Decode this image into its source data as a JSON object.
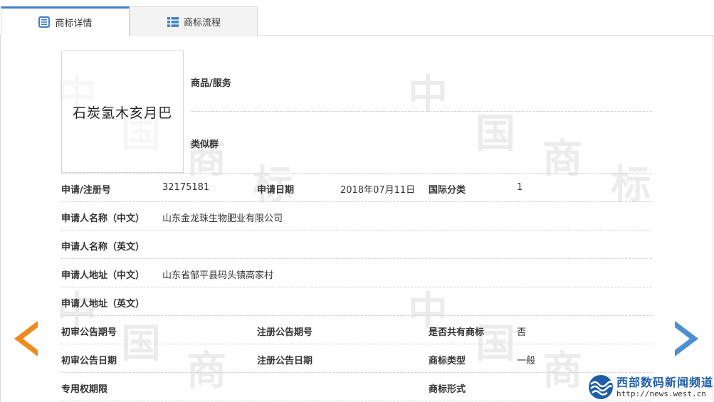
{
  "tabs": [
    {
      "label": "商标详情",
      "active": true
    },
    {
      "label": "商标流程",
      "active": false
    }
  ],
  "watermark": {
    "chars": [
      "中",
      "国",
      "商",
      "标"
    ]
  },
  "trademark": {
    "image_text": "石炭氢木亥月巴"
  },
  "top_fields": {
    "goods_services_label": "商品/服务",
    "similar_group_label": "类似群"
  },
  "rows": {
    "reg_no_label": "申请/注册号",
    "reg_no_value": "32175181",
    "apply_date_label": "申请日期",
    "apply_date_value": "2018年07月11日",
    "intl_class_label": "国际分类",
    "intl_class_value": "1",
    "applicant_cn_label": "申请人名称（中文）",
    "applicant_cn_value": "山东金龙珠生物肥业有限公司",
    "applicant_en_label": "申请人名称（英文）",
    "address_cn_label": "申请人地址（中文）",
    "address_cn_value": "山东省邹平县码头镇高家村",
    "address_en_label": "申请人地址（英文）",
    "prelim_no_label": "初审公告期号",
    "reg_pub_no_label": "注册公告期号",
    "shared_label": "是否共有商标",
    "shared_value": "否",
    "prelim_date_label": "初审公告日期",
    "reg_pub_date_label": "注册公告日期",
    "tm_type_label": "商标类型",
    "tm_type_value": "一般",
    "exclusive_period_label": "专用权期限",
    "tm_form_label": "商标形式"
  },
  "brand": {
    "name": "西部数码新闻频道",
    "url": "http://news.west.cn",
    "color": "#1f5ea8"
  },
  "colors": {
    "accent": "#3f80c8",
    "arrow_left": "#f08a1c",
    "arrow_right": "#4e8fd3"
  }
}
